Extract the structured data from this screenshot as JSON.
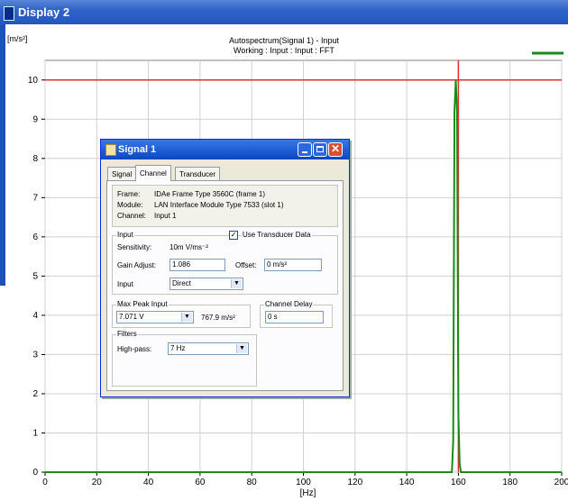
{
  "window": {
    "title": "Display 2"
  },
  "chart_data": {
    "type": "line",
    "title": "Autospectrum(Signal 1) - Input",
    "subtitle": "Working : Input : Input : FFT",
    "xlabel": "[Hz]",
    "ylabel": "[m/s²]",
    "xlim": [
      0,
      200
    ],
    "ylim": [
      0,
      10.5
    ],
    "x_ticks": [
      "0",
      "20",
      "40",
      "60",
      "80",
      "100",
      "120",
      "140",
      "160",
      "180",
      "200"
    ],
    "y_ticks": [
      "0",
      "1",
      "2",
      "3",
      "4",
      "5",
      "6",
      "7",
      "8",
      "9",
      "10"
    ],
    "grid": true,
    "series": [
      {
        "color": "#1a8a1a",
        "x": [
          0,
          157.5,
          158,
          158.5,
          159,
          159.5,
          160,
          160.5,
          161,
          200
        ],
        "y": [
          0,
          0,
          0.8,
          9.2,
          10.0,
          9.2,
          1.5,
          0.2,
          0,
          0
        ]
      }
    ],
    "reference_line": {
      "y": 10.0,
      "x": 160,
      "color": "#e03030"
    },
    "legend_color": "#1a8a1a"
  },
  "dialog": {
    "title": "Signal 1",
    "tabs": [
      "Signal",
      "Channel",
      "Transducer"
    ],
    "active_tab": "Channel",
    "frame_label": "Frame:",
    "frame_value": "IDAe Frame Type 3560C (frame 1)",
    "module_label": "Module:",
    "module_value": "LAN Interface Module Type 7533 (slot 1)",
    "channel_label": "Channel:",
    "channel_value": "Input 1",
    "input_group": "Input",
    "use_transducer": "Use Transducer Data",
    "sensitivity_label": "Sensitivity:",
    "sensitivity_value": "10m V/ms⁻²",
    "gain_label": "Gain Adjust:",
    "gain_value": "1.086",
    "offset_label": "Offset:",
    "offset_value": "0 m/s²",
    "input_label": "Input",
    "input_value": "Direct",
    "max_peak_group": "Max Peak Input",
    "max_peak_value": "7.071 V",
    "max_peak_accel": "767.9 m/s²",
    "channel_delay_group": "Channel Delay",
    "channel_delay_value": "0 s",
    "filters_group": "Filters",
    "highpass_label": "High-pass:",
    "highpass_value": "7 Hz"
  }
}
